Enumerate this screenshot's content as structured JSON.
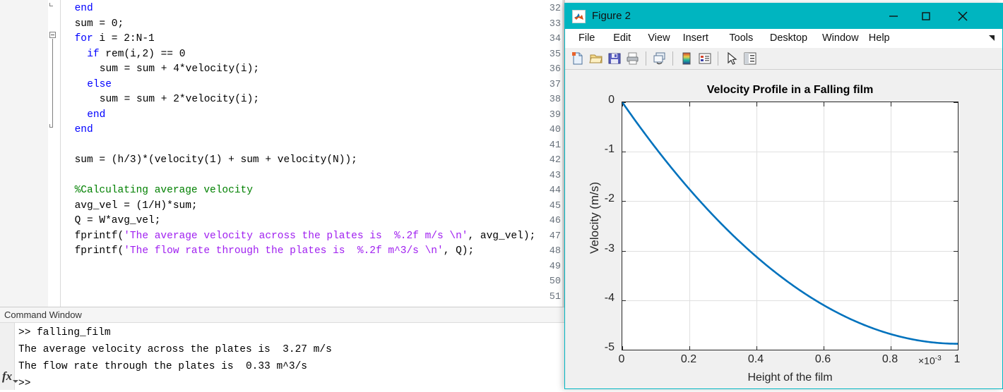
{
  "editor": {
    "first_line_number": 32,
    "lines": [
      {
        "n": 32,
        "indent": 2,
        "segments": [
          {
            "t": "end",
            "c": "kw"
          }
        ]
      },
      {
        "n": 33,
        "indent": 2,
        "segments": [
          {
            "t": "sum = 0;",
            "c": "plain"
          }
        ]
      },
      {
        "n": 34,
        "indent": 2,
        "segments": [
          {
            "t": "for",
            "c": "kw"
          },
          {
            "t": " i = 2:N-1",
            "c": "plain"
          }
        ]
      },
      {
        "n": 35,
        "indent": 4,
        "segments": [
          {
            "t": "if",
            "c": "kw"
          },
          {
            "t": " rem(i,2) == 0",
            "c": "plain"
          }
        ]
      },
      {
        "n": 36,
        "indent": 6,
        "segments": [
          {
            "t": "sum = sum + 4*velocity(i);",
            "c": "plain"
          }
        ]
      },
      {
        "n": 37,
        "indent": 4,
        "segments": [
          {
            "t": "else",
            "c": "kw"
          }
        ]
      },
      {
        "n": 38,
        "indent": 6,
        "segments": [
          {
            "t": "sum = sum + 2*velocity(i);",
            "c": "plain"
          }
        ]
      },
      {
        "n": 39,
        "indent": 4,
        "segments": [
          {
            "t": "end",
            "c": "kw"
          }
        ]
      },
      {
        "n": 40,
        "indent": 2,
        "segments": [
          {
            "t": "end",
            "c": "kw"
          }
        ]
      },
      {
        "n": 41,
        "indent": 0,
        "segments": []
      },
      {
        "n": 42,
        "indent": 2,
        "segments": [
          {
            "t": "sum = (h/3)*(velocity(1) + sum + velocity(N));",
            "c": "plain"
          }
        ]
      },
      {
        "n": 43,
        "indent": 0,
        "segments": []
      },
      {
        "n": 44,
        "indent": 2,
        "segments": [
          {
            "t": "%Calculating",
            "c": "cmt"
          },
          {
            "t": " average velocity",
            "c": "cmt"
          }
        ]
      },
      {
        "n": 45,
        "indent": 2,
        "segments": [
          {
            "t": "avg_vel = (1/H)*sum;",
            "c": "plain"
          }
        ]
      },
      {
        "n": 46,
        "indent": 2,
        "segments": [
          {
            "t": "Q = W*avg_vel;",
            "c": "plain"
          }
        ]
      },
      {
        "n": 47,
        "indent": 2,
        "segments": [
          {
            "t": "fprintf(",
            "c": "plain"
          },
          {
            "t": "'The average velocity across the plates is  %.2f m/s \\n'",
            "c": "str"
          },
          {
            "t": ", avg_vel);",
            "c": "plain"
          }
        ]
      },
      {
        "n": 48,
        "indent": 2,
        "segments": [
          {
            "t": "fprintf(",
            "c": "plain"
          },
          {
            "t": "'The flow rate through the plates is  %.2f m^3/s \\n'",
            "c": "str"
          },
          {
            "t": ", Q);",
            "c": "plain"
          }
        ]
      },
      {
        "n": 49,
        "indent": 0,
        "segments": []
      },
      {
        "n": 50,
        "indent": 0,
        "segments": []
      },
      {
        "n": 51,
        "indent": 0,
        "segments": []
      }
    ]
  },
  "command_window": {
    "title": "Command Window",
    "prompt_symbol": ">>",
    "fx_label": "fx",
    "lines": [
      ">> falling_film",
      "The average velocity across the plates is  3.27 m/s",
      "The flow rate through the plates is  0.33 m^3/s",
      ">>"
    ]
  },
  "figure_window": {
    "title": "Figure 2",
    "app_icon": "matlab-icon",
    "titlebar_color": "#00b5c0",
    "window_buttons": [
      {
        "name": "minimize-button",
        "glyph": "minimize-icon"
      },
      {
        "name": "maximize-button",
        "glyph": "maximize-icon"
      },
      {
        "name": "close-button",
        "glyph": "close-icon"
      }
    ],
    "menu": [
      "File",
      "Edit",
      "View",
      "Insert",
      "Tools",
      "Desktop",
      "Window",
      "Help"
    ],
    "menu_expand_icon": "expand-arrow-icon",
    "toolbar": [
      {
        "name": "new-figure-icon",
        "tooltip": "New Figure"
      },
      {
        "name": "open-file-icon",
        "tooltip": "Open File"
      },
      {
        "name": "save-figure-icon",
        "tooltip": "Save Figure"
      },
      {
        "name": "print-figure-icon",
        "tooltip": "Print Figure"
      },
      {
        "name": "link-plot-icon",
        "tooltip": "Link Plot"
      },
      {
        "name": "insert-colorbar-icon",
        "tooltip": "Insert Colorbar"
      },
      {
        "name": "insert-legend-icon",
        "tooltip": "Insert Legend"
      },
      {
        "name": "edit-plot-pointer-icon",
        "tooltip": "Edit Plot"
      },
      {
        "name": "property-inspector-icon",
        "tooltip": "Open Property Inspector"
      }
    ]
  },
  "chart_data": {
    "type": "line",
    "title": "Velocity Profile in a Falling film",
    "xlabel": "Height of the film",
    "ylabel": "Velocity (m/s)",
    "x_exponent_label": "×10",
    "x_exponent_power": "-3",
    "xlim": [
      0,
      0.001
    ],
    "ylim": [
      -5,
      0
    ],
    "xticks": [
      0,
      0.0002,
      0.0004,
      0.0006,
      0.0008,
      0.001
    ],
    "xticklabels": [
      "0",
      "0.2",
      "0.4",
      "0.6",
      "0.8",
      "1"
    ],
    "yticks": [
      -5,
      -4,
      -3,
      -2,
      -1,
      0
    ],
    "yticklabels": [
      "-5",
      "-4",
      "-3",
      "-2",
      "-1",
      "0"
    ],
    "grid": true,
    "legend": "none",
    "line_color": "#0072BD",
    "line_width": 2.5,
    "series": [
      {
        "name": "velocity",
        "x": [
          0,
          0.0001,
          0.0002,
          0.0003,
          0.0004,
          0.0005,
          0.0006,
          0.0007,
          0.0008,
          0.0009,
          0.001
        ],
        "y": [
          0,
          -0.93,
          -1.76,
          -2.49,
          -3.12,
          -3.66,
          -4.1,
          -4.44,
          -4.69,
          -4.83,
          -4.88
        ]
      }
    ]
  }
}
